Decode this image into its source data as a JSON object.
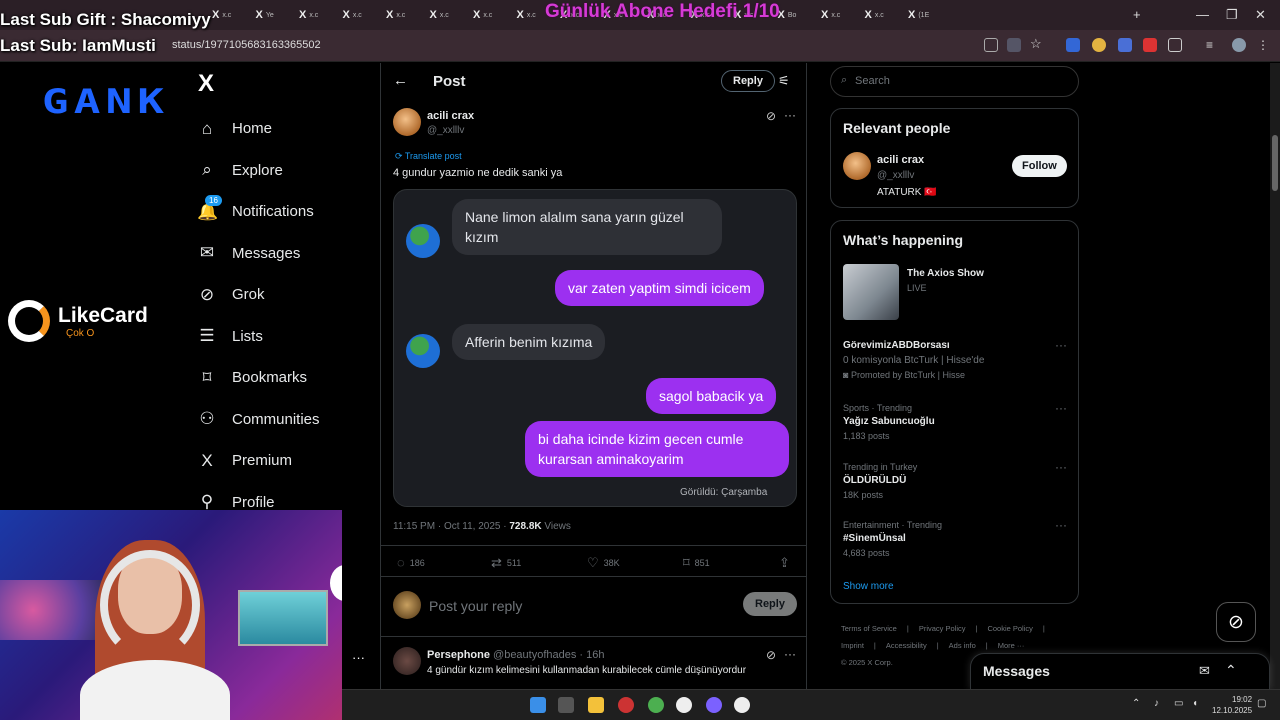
{
  "overlay": {
    "last_sub_gift": "Last Sub Gift : Shacomiyy",
    "last_sub": "Last Sub: IamMusti",
    "goal": "Günlük Abone Hedefi 1/10"
  },
  "browser": {
    "url": "status/1977105683163365502",
    "tab_labels": [
      "x.c",
      "Ye",
      "x.c",
      "x.c",
      "x.c",
      "x.c",
      "x.c",
      "x.c",
      "x.c",
      "x.c",
      "x.c",
      "x.c",
      "x.c",
      "Bo",
      "x.c",
      "x.c",
      "(1E"
    ]
  },
  "branding": {
    "grank": "GANK",
    "likecard_name": "LikeCard",
    "likecard_sub": "Çok O"
  },
  "nav": {
    "logo": "X",
    "notifications_badge": "16",
    "items": [
      {
        "label": "Home",
        "icon": "home-icon"
      },
      {
        "label": "Explore",
        "icon": "search-icon"
      },
      {
        "label": "Notifications",
        "icon": "bell-icon"
      },
      {
        "label": "Messages",
        "icon": "mail-icon"
      },
      {
        "label": "Grok",
        "icon": "grok-icon"
      },
      {
        "label": "Lists",
        "icon": "list-icon"
      },
      {
        "label": "Bookmarks",
        "icon": "bookmark-icon"
      },
      {
        "label": "Communities",
        "icon": "people-icon"
      },
      {
        "label": "Premium",
        "icon": "x-icon"
      },
      {
        "label": "Profile",
        "icon": "person-icon"
      }
    ]
  },
  "post": {
    "header_title": "Post",
    "reply_label": "Reply",
    "author_name": "acili crax",
    "author_handle": "@_xxlllv",
    "translate": "Translate post",
    "text": "4 gundur yazmio ne dedik sanki ya",
    "chat": {
      "msg1": "Nane limon alalım sana yarın güzel kızım",
      "msg2": "var zaten yaptim simdi icicem",
      "msg3": "Afferin benim kızıma",
      "msg4": "sagol babacik ya",
      "msg5": "bi daha icinde kizim gecen cumle kurarsan aminakoyarim",
      "seen": "Görüldü: Çarşamba"
    },
    "time": "11:15 PM · Oct 11, 2025 · ",
    "views_count": "728.8K",
    "views_label": " Views",
    "stats": {
      "replies": "186",
      "reposts": "511",
      "likes": "38K",
      "bookmarks": "851"
    },
    "reply_placeholder": "Post your reply",
    "reply_button": "Reply"
  },
  "reply": {
    "name": "Persephone",
    "handle": "@beautyofhades · 16h",
    "text": "4 gündür kızım kelimesini kullanmadan kurabilecek cümle düşünüyordur"
  },
  "sidebar": {
    "search_placeholder": "Search",
    "relevant_title": "Relevant people",
    "person_name": "acili crax",
    "person_handle": "@_xxlllv",
    "person_bio": "ATATURK 🇹🇷",
    "follow_label": "Follow",
    "happening_title": "What’s happening",
    "axios_name": "The Axios Show",
    "axios_status": "LIVE",
    "promo": {
      "title": "GörevimizABDBorsası",
      "line": "0 komisyonla BtcTurk | Hisse'de",
      "promoted": "Promoted by BtcTurk | Hisse"
    },
    "trends": [
      {
        "cat": "Sports · Trending",
        "title": "Yağız Sabuncuoğlu",
        "posts": "1,183 posts"
      },
      {
        "cat": "Trending in Turkey",
        "title": "ÖLDÜRÜLDÜ",
        "posts": "18K posts"
      },
      {
        "cat": "Entertainment · Trending",
        "title": "#SinemÜnsal",
        "posts": "4,683 posts"
      }
    ],
    "show_more": "Show more",
    "footer": {
      "line1": [
        "Terms of Service",
        "|",
        "Privacy Policy",
        "|",
        "Cookie Policy",
        "|"
      ],
      "line2": [
        "Imprint",
        "|",
        "Accessibility",
        "|",
        "Ads info",
        "|",
        "More ···"
      ],
      "copyright": "© 2025 X Corp."
    }
  },
  "messages_drawer": {
    "title": "Messages"
  },
  "taskbar": {
    "time": "19:02",
    "date": "12.10.2025"
  },
  "colors": {
    "accent": "#1d9bf0",
    "bubble_out": "#9c30f0",
    "goal": "#d63ad6"
  }
}
